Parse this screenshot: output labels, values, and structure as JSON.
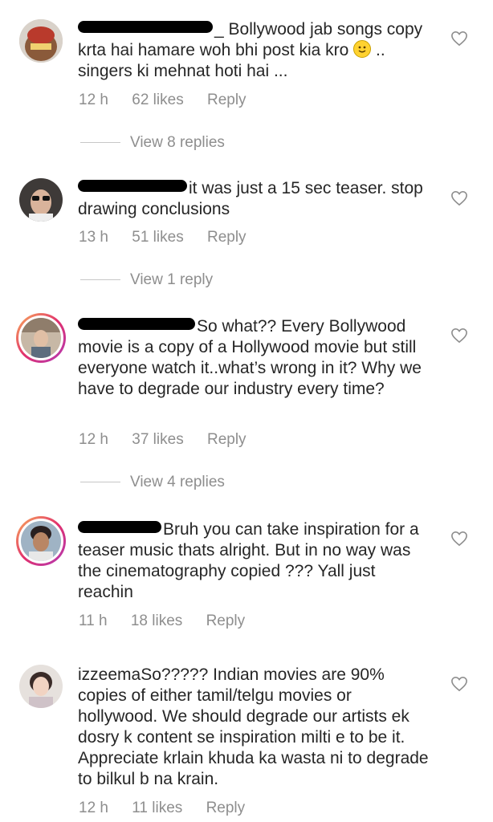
{
  "comments": [
    {
      "text": "Bollywood jab songs copy krta hai hamare woh bhi post kia kro",
      "text_end": ".. singers ki mehnat hoti hai ...",
      "time": "12 h",
      "likes": "62 likes",
      "reply": "Reply",
      "view_replies": "View 8 replies"
    },
    {
      "text": "it was just a 15 sec teaser. stop drawing conclusions",
      "time": "13 h",
      "likes": "51 likes",
      "reply": "Reply",
      "view_replies": "View 1 reply"
    },
    {
      "text": "So what?? Every Bollywood movie is a copy of a Hollywood movie but still everyone watch it..what’s wrong in it? Why we have to degrade our industry every time?",
      "time": "12 h",
      "likes": "37 likes",
      "reply": "Reply",
      "view_replies": "View 4 replies"
    },
    {
      "text": "Bruh you can take inspiration for a teaser music thats alright. But in no way was the cinematography copied ??? Yall just reachin",
      "time": "11 h",
      "likes": "18 likes",
      "reply": "Reply"
    },
    {
      "username": "izzeema",
      "text": "So????? Indian movies are 90% copies of either tamil/telgu movies or hollywood. We should degrade our artists ek dosry k content se inspiration milti e to be it. Appreciate krlain khuda ka wasta ni to degrade to bilkul b na krain.",
      "time": "12 h",
      "likes": "11 likes",
      "reply": "Reply"
    }
  ],
  "icons": {
    "like": "heart-outline-icon",
    "emoji": "slightly-smiling-face-icon"
  }
}
